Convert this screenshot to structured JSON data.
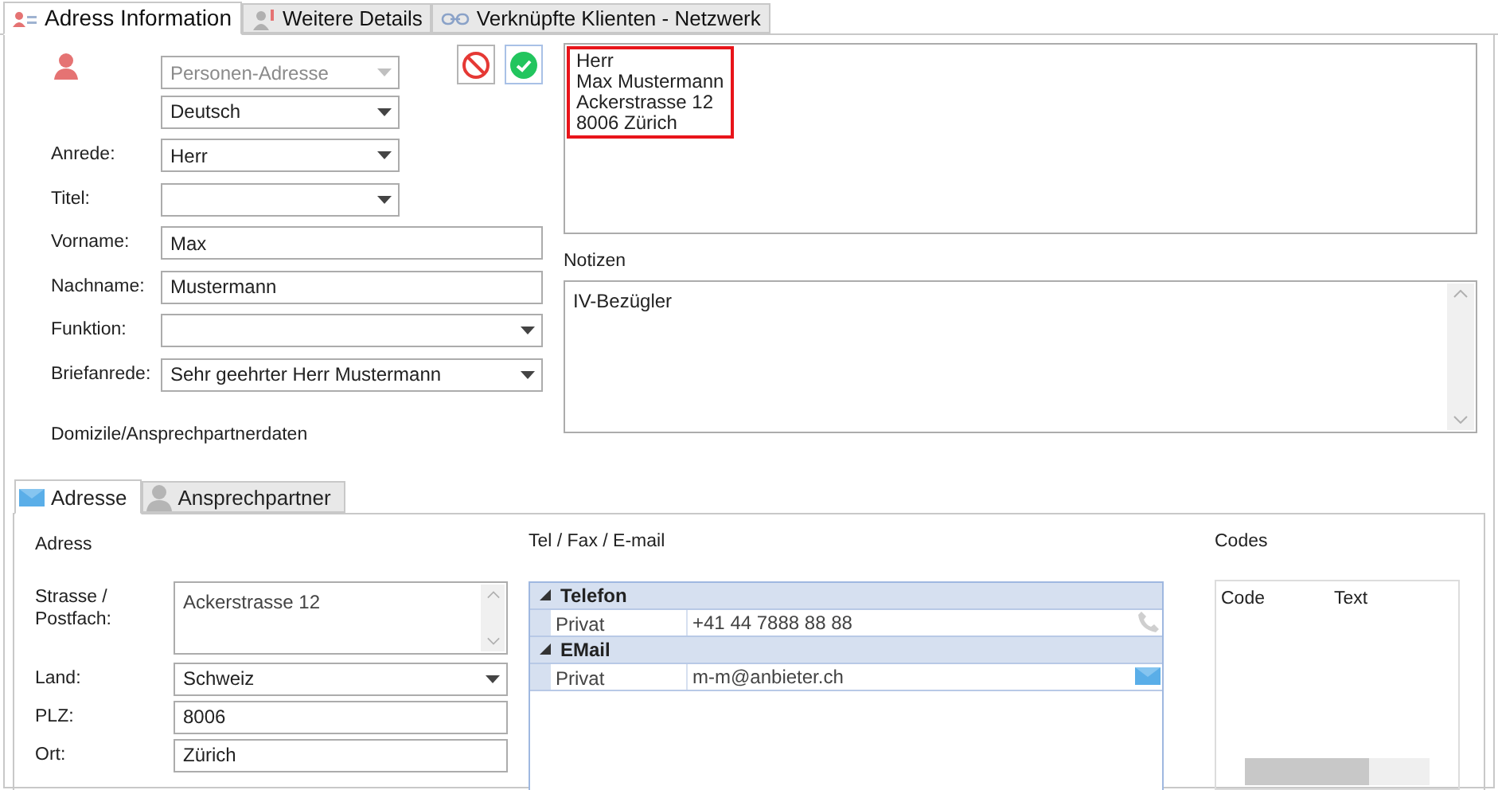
{
  "tabs": [
    {
      "label": "Adress Information",
      "selected": true
    },
    {
      "label": "Weitere Details",
      "selected": false
    },
    {
      "label": "Verknüpfte Klienten -  Netzwerk",
      "selected": false
    }
  ],
  "type_select": {
    "value": "Personen-Adresse",
    "disabled": true
  },
  "language_select": {
    "value": "Deutsch",
    "disabled": false
  },
  "fields": [
    {
      "label": "Anrede:",
      "value": "Herr",
      "kind": "dropdown"
    },
    {
      "label": "Titel:",
      "kind": "dropdown"
    },
    {
      "label": "Vorname:",
      "value": "Max",
      "kind": "text"
    },
    {
      "label": "Nachname:",
      "value": "Mustermann",
      "kind": "text"
    },
    {
      "label": "Funktion:",
      "kind": "dropdown"
    },
    {
      "label": "Briefanrede:",
      "value": "Sehr geehrter Herr Mustermann",
      "kind": "dropdown"
    }
  ],
  "address_preview": {
    "lines": [
      "Herr",
      "Max Mustermann",
      "Ackerstrasse 12",
      "8006 Zürich"
    ],
    "highlighted": true
  },
  "notes": {
    "label": "Notizen",
    "value": "IV-Bezügler"
  },
  "section_label": "Domizile/Ansprechpartnerdaten",
  "sub_tabs": [
    {
      "label": "Adresse",
      "selected": true
    },
    {
      "label": "Ansprechpartner",
      "selected": false
    }
  ],
  "address": {
    "title": "Adress",
    "fields": [
      {
        "label": "Strasse / Postfach:",
        "value": "Ackerstrasse 12",
        "kind": "textarea"
      },
      {
        "label": "Land:",
        "value": "Schweiz",
        "kind": "dropdown"
      },
      {
        "label": "PLZ:",
        "value": "8006",
        "kind": "text"
      },
      {
        "label": "Ort:",
        "value": "Zürich",
        "kind": "text"
      }
    ]
  },
  "contacts": {
    "title": "Tel / Fax / E-mail",
    "groups": [
      {
        "name": "Telefon",
        "expanded": true,
        "rows": [
          {
            "label": "Privat",
            "value": "+41 44 7888 88 88",
            "kind": "phone"
          }
        ]
      },
      {
        "name": "EMail",
        "expanded": true,
        "rows": [
          {
            "label": "Privat",
            "value": "m-m@anbieter.ch",
            "kind": "email"
          }
        ]
      }
    ]
  },
  "codes": {
    "title": "Codes",
    "columns": [
      "Code",
      "Text"
    ]
  }
}
